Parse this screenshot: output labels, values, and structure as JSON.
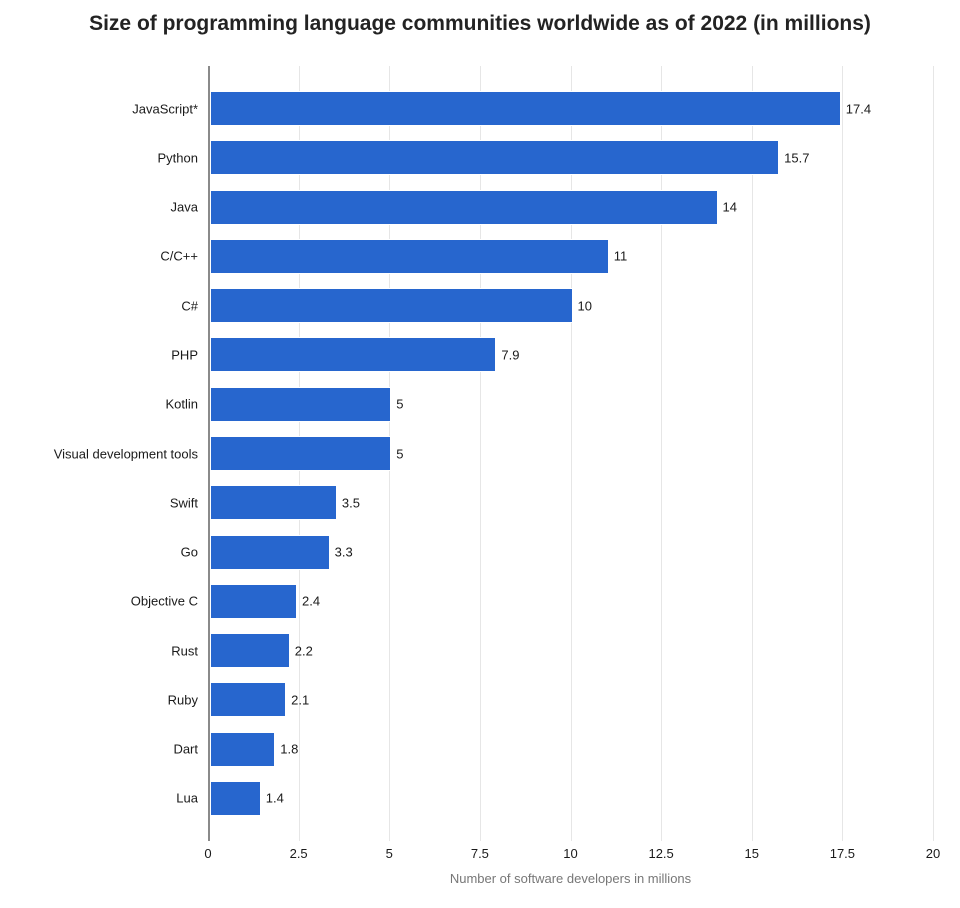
{
  "chart_data": {
    "type": "bar",
    "orientation": "horizontal",
    "title": "Size of programming language communities worldwide as of 2022 (in millions)",
    "xlabel": "Number of software developers in millions",
    "ylabel": "",
    "xlim": [
      0,
      20
    ],
    "xticks": [
      0,
      2.5,
      5,
      7.5,
      10,
      12.5,
      15,
      17.5,
      20
    ],
    "categories": [
      "JavaScript*",
      "Python",
      "Java",
      "C/C++",
      "C#",
      "PHP",
      "Kotlin",
      "Visual development tools",
      "Swift",
      "Go",
      "Objective C",
      "Rust",
      "Ruby",
      "Dart",
      "Lua"
    ],
    "values": [
      17.4,
      15.7,
      14,
      11,
      10,
      7.9,
      5,
      5,
      3.5,
      3.3,
      2.4,
      2.2,
      2.1,
      1.8,
      1.4
    ],
    "bar_color": "#2766ce"
  }
}
